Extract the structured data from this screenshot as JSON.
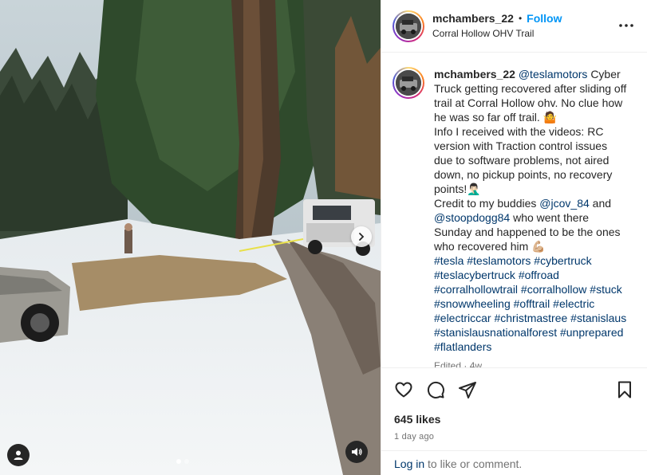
{
  "post": {
    "username": "mchambers_22",
    "separator": "•",
    "follow_label": "Follow",
    "location": "Corral Hollow OHV Trail"
  },
  "caption": {
    "username": "mchambers_22",
    "mention": "@teslamotors",
    "line1": "Cyber Truck getting recovered after sliding off trail at Corral Hollow ohv. No clue how he was so far off trail. 🤷",
    "line2": "Info I received with the videos: RC version with Traction control issues due to software problems, not aired down, no pickup points, no recovery points!🤦🏻‍♂️",
    "credit_text_1": "Credit to my buddies",
    "credit_mention_1": "@jcov_84",
    "credit_and": "and",
    "credit_mention_2": "@stoopdogg84",
    "credit_text_2": "who went there Sunday and happened to be the ones who recovered him 💪🏼",
    "hashtags": "#tesla #teslamotors #cybertruck #teslacybertruck #offroad #corralhollowtrail #corralhollow #stuck #snowwheeling #offtrail #electric #electriccar #christmastree #stanislaus #stanislausnationalforest #unprepared #flatlanders",
    "edited": "Edited · 4w"
  },
  "stats": {
    "likes": "645 likes",
    "date": "1 day ago"
  },
  "login": {
    "link": "Log in",
    "rest": "to like or comment."
  },
  "icons": {
    "like": "heart-icon",
    "comment": "comment-icon",
    "share": "share-icon",
    "save": "bookmark-icon",
    "more": "more-icon",
    "next": "chevron-right-icon",
    "tag": "user-tag-icon",
    "mute": "volume-icon"
  },
  "colors": {
    "accent": "#0095f6",
    "link": "#00376b",
    "muted": "#737373"
  },
  "carousel": {
    "slide_count": 2,
    "active_index": 0
  }
}
